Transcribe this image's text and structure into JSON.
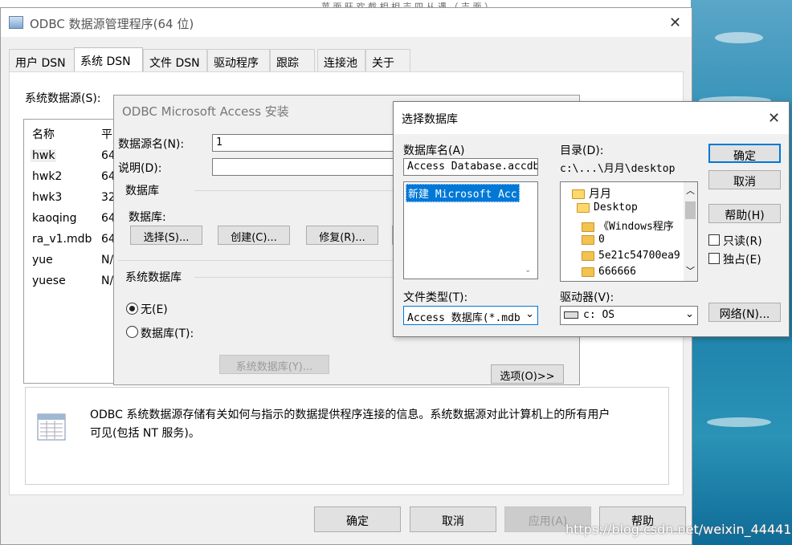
{
  "watermark": "https://blog.csdn.net/weixin_44441338",
  "top_strip": "         苹 面 旺 欢                    截 相 相                    吉 四 从 遇         （ 吉 面 ）",
  "main": {
    "title": "ODBC 数据源管理程序(64 位)",
    "tabs": [
      "用户 DSN",
      "系统 DSN",
      "文件 DSN",
      "驱动程序",
      "跟踪",
      "连接池",
      "关于"
    ],
    "active_tab": "系统 DSN",
    "list_label": "系统数据源(S):",
    "list_header": "名称",
    "list_header2": "平",
    "rows": [
      {
        "name": "hwk",
        "p": "64"
      },
      {
        "name": "hwk2",
        "p": "64"
      },
      {
        "name": "hwk3",
        "p": "32"
      },
      {
        "name": "kaoqing",
        "p": "64"
      },
      {
        "name": "ra_v1.mdb",
        "p": "64"
      },
      {
        "name": "yue",
        "p": "N/"
      },
      {
        "name": "yuese",
        "p": "N/"
      }
    ],
    "info": "ODBC 系统数据源存储有关如何与指示的数据提供程序连接的信息。系统数据源对此计算机上的所有用户",
    "info2": "可见(包括 NT 服务)。",
    "buttons": {
      "ok": "确定",
      "cancel": "取消",
      "apply": "应用(A)",
      "help": "帮助"
    }
  },
  "access": {
    "title": "ODBC Microsoft Access 安装",
    "dsn_label": "数据源名(N):",
    "dsn_value": "1",
    "desc_label": "说明(D):",
    "desc_value": "",
    "db_group": "数据库",
    "db_label": "数据库:",
    "btn_select": "选择(S)...",
    "btn_create": "创建(C)...",
    "btn_repair": "修复(R)...",
    "sysdb_group": "系统数据库",
    "radio_none": "无(E)",
    "radio_db": "数据库(T):",
    "btn_sysdb": "系统数据库(Y)...",
    "btn_options": "选项(O)>>"
  },
  "select": {
    "title": "选择数据库",
    "dbname_label": "数据库名(A)",
    "dbname_value": "Access Database.accdb",
    "file_list": [
      "新建 Microsoft Acc"
    ],
    "dir_label": "目录(D):",
    "dir_value": "c:\\...\\月月\\desktop",
    "dirs": [
      "月月",
      "Desktop",
      "《Windows程序",
      "0",
      "5e21c54700ea9",
      "666666"
    ],
    "ok": "确定",
    "cancel": "取消",
    "help": "帮助(H)",
    "readonly": "只读(R)",
    "exclusive": "独占(E)",
    "type_label": "文件类型(T):",
    "type_value": "Access 数据库(*.mdb",
    "drive_label": "驱动器(V):",
    "drive_value": "c: OS",
    "network": "网络(N)..."
  }
}
